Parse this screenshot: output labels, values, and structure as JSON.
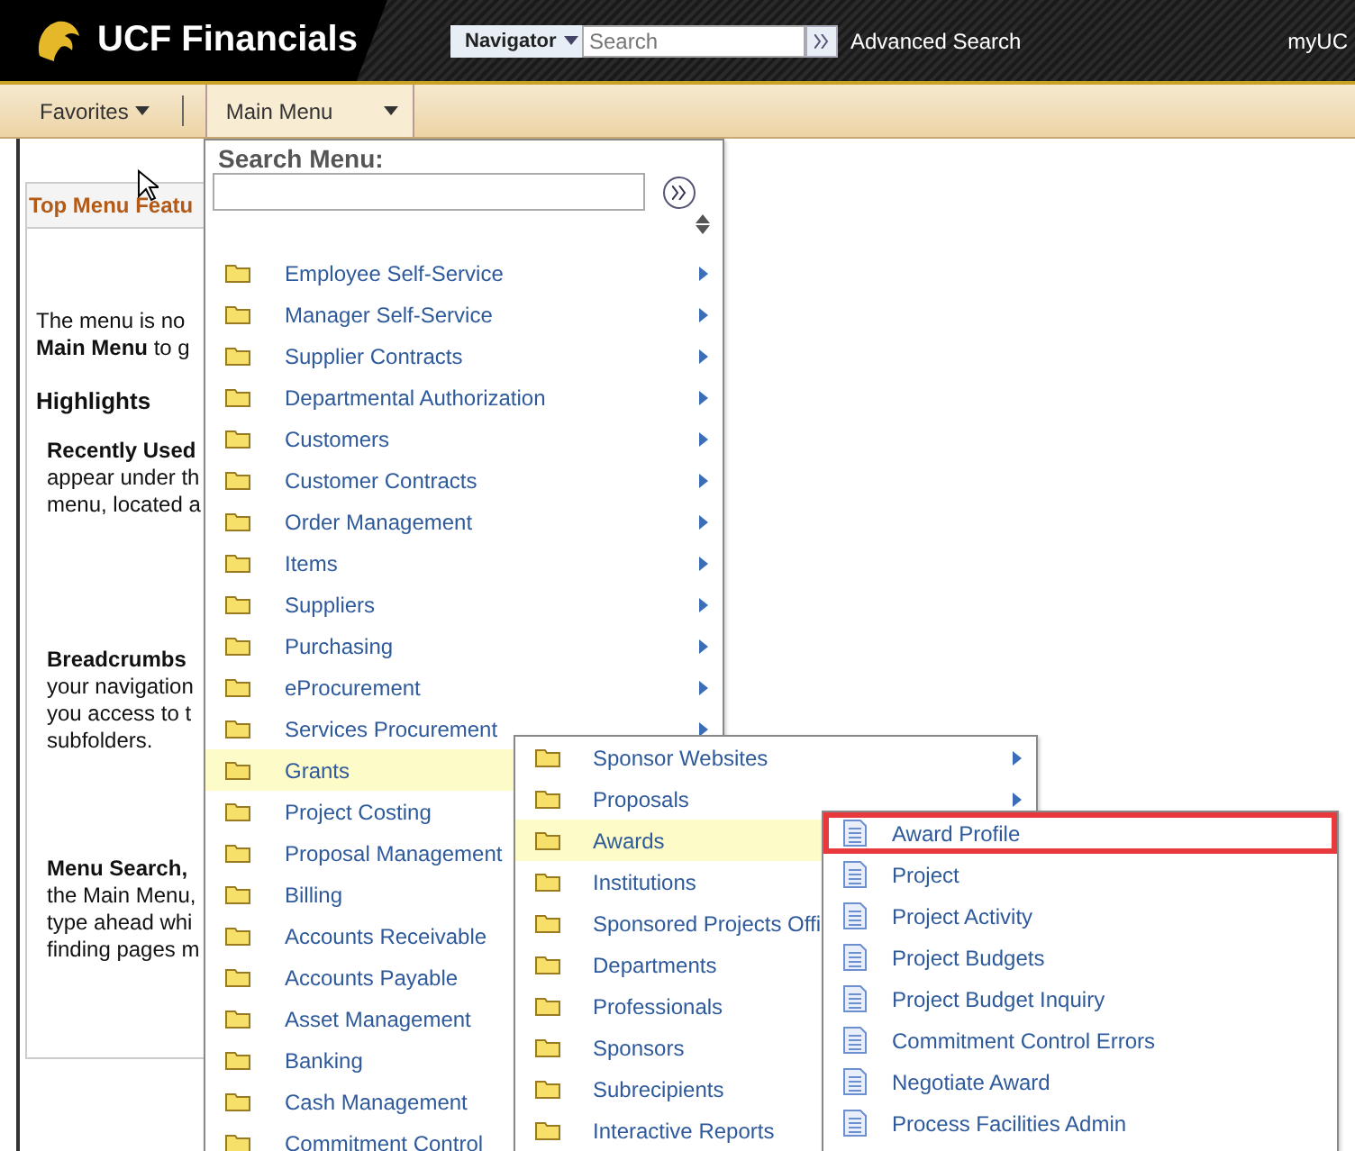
{
  "header": {
    "title": "UCF Financials",
    "navigator": "Navigator",
    "search_placeholder": "Search",
    "advanced_search": "Advanced Search",
    "user_link": "myUC"
  },
  "navbar": {
    "favorites": "Favorites",
    "main_menu": "Main Menu"
  },
  "panel": {
    "title": "Top Menu Featu",
    "blocks": [
      {
        "kind": "intro",
        "lines": [
          "The menu is no",
          "**Main Menu** to g"
        ]
      },
      {
        "kind": "heading",
        "lines": [
          "Highlights"
        ]
      },
      {
        "kind": "feature",
        "lines": [
          "**Recently Used**",
          "appear under th",
          "menu, located a"
        ]
      },
      {
        "kind": "feature",
        "lines": [
          "**Breadcrumbs**",
          "your navigation",
          "you access to t",
          "subfolders."
        ]
      },
      {
        "kind": "feature",
        "lines": [
          "**Menu Search,**",
          "the Main Menu,",
          "type ahead whi",
          "finding pages m"
        ]
      }
    ]
  },
  "search_menu": {
    "label": "Search Menu:"
  },
  "menus": [
    {
      "items": [
        {
          "kind": "folder",
          "label": "Employee Self-Service",
          "has_submenu": true,
          "selected": false
        },
        {
          "kind": "folder",
          "label": "Manager Self-Service",
          "has_submenu": true,
          "selected": false
        },
        {
          "kind": "folder",
          "label": "Supplier Contracts",
          "has_submenu": true,
          "selected": false
        },
        {
          "kind": "folder",
          "label": "Departmental Authorization",
          "has_submenu": true,
          "selected": false
        },
        {
          "kind": "folder",
          "label": "Customers",
          "has_submenu": true,
          "selected": false
        },
        {
          "kind": "folder",
          "label": "Customer Contracts",
          "has_submenu": true,
          "selected": false
        },
        {
          "kind": "folder",
          "label": "Order Management",
          "has_submenu": true,
          "selected": false
        },
        {
          "kind": "folder",
          "label": "Items",
          "has_submenu": true,
          "selected": false
        },
        {
          "kind": "folder",
          "label": "Suppliers",
          "has_submenu": true,
          "selected": false
        },
        {
          "kind": "folder",
          "label": "Purchasing",
          "has_submenu": true,
          "selected": false
        },
        {
          "kind": "folder",
          "label": "eProcurement",
          "has_submenu": true,
          "selected": false
        },
        {
          "kind": "folder",
          "label": "Services Procurement",
          "has_submenu": true,
          "selected": false
        },
        {
          "kind": "folder",
          "label": "Grants",
          "selected": true
        },
        {
          "kind": "folder",
          "label": "Project Costing",
          "selected": false
        },
        {
          "kind": "folder",
          "label": "Proposal Management",
          "selected": false
        },
        {
          "kind": "folder",
          "label": "Billing",
          "selected": false
        },
        {
          "kind": "folder",
          "label": "Accounts Receivable",
          "selected": false
        },
        {
          "kind": "folder",
          "label": "Accounts Payable",
          "selected": false
        },
        {
          "kind": "folder",
          "label": "Asset Management",
          "selected": false
        },
        {
          "kind": "folder",
          "label": "Banking",
          "selected": false
        },
        {
          "kind": "folder",
          "label": "Cash Management",
          "selected": false
        },
        {
          "kind": "folder",
          "label": "Commitment Control",
          "selected": false
        }
      ]
    },
    {
      "items": [
        {
          "kind": "folder",
          "label": "Sponsor Websites",
          "has_submenu": true,
          "selected": false
        },
        {
          "kind": "folder",
          "label": "Proposals",
          "has_submenu": true,
          "selected": false
        },
        {
          "kind": "folder",
          "label": "Awards",
          "selected": true
        },
        {
          "kind": "folder",
          "label": "Institutions",
          "selected": false
        },
        {
          "kind": "folder",
          "label": "Sponsored Projects Offi",
          "selected": false
        },
        {
          "kind": "folder",
          "label": "Departments",
          "selected": false
        },
        {
          "kind": "folder",
          "label": "Professionals",
          "selected": false
        },
        {
          "kind": "folder",
          "label": "Sponsors",
          "selected": false
        },
        {
          "kind": "folder",
          "label": "Subrecipients",
          "selected": false
        },
        {
          "kind": "folder",
          "label": "Interactive Reports",
          "selected": false
        }
      ]
    },
    {
      "items": [
        {
          "kind": "page",
          "label": "Award Profile",
          "outlined": true,
          "selected": false
        },
        {
          "kind": "page",
          "label": "Project",
          "outlined": false,
          "selected": false
        },
        {
          "kind": "page",
          "label": "Project Activity",
          "outlined": false,
          "selected": false
        },
        {
          "kind": "page",
          "label": "Project Budgets",
          "outlined": false,
          "selected": false
        },
        {
          "kind": "page",
          "label": "Project Budget Inquiry",
          "outlined": false,
          "selected": false
        },
        {
          "kind": "page",
          "label": "Commitment Control Errors",
          "outlined": false,
          "selected": false
        },
        {
          "kind": "page",
          "label": "Negotiate Award",
          "outlined": false,
          "selected": false
        },
        {
          "kind": "page",
          "label": "Process Facilities Admin",
          "outlined": false,
          "selected": false
        }
      ]
    }
  ]
}
